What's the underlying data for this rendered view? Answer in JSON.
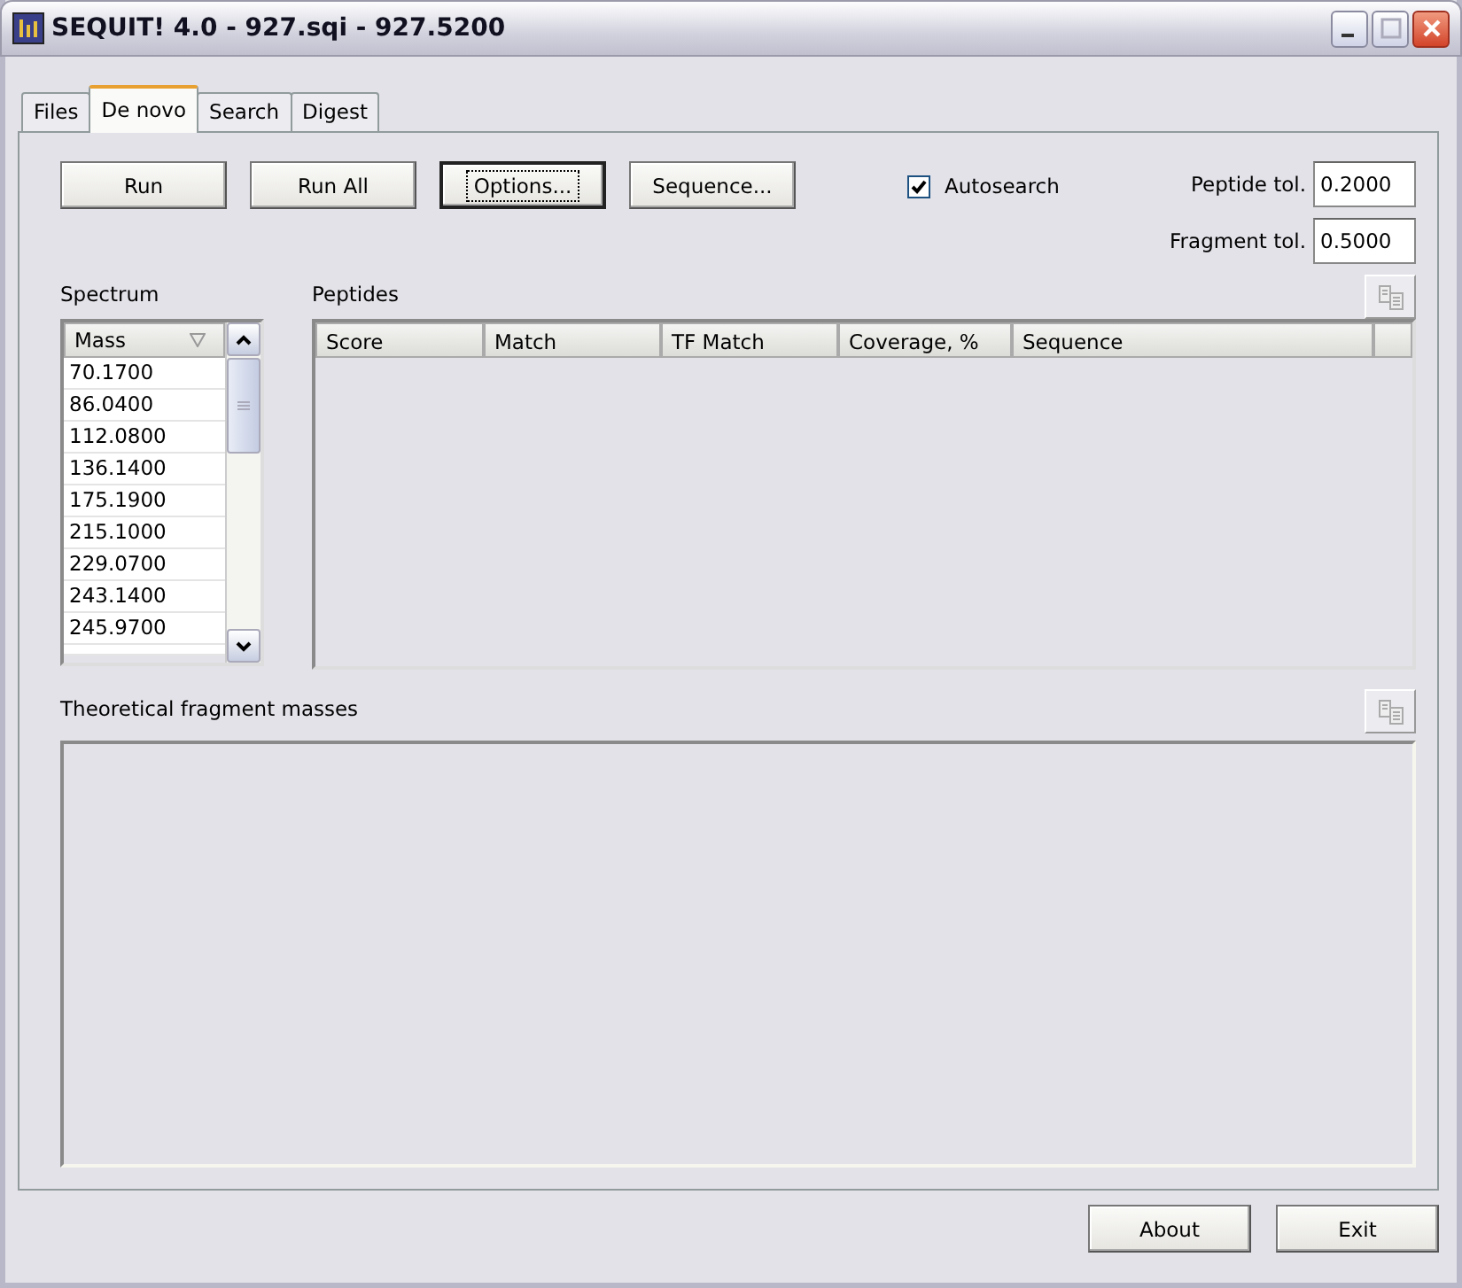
{
  "window": {
    "title": "SEQUIT! 4.0 - 927.sqi - 927.5200"
  },
  "tabs": [
    {
      "label": "Files",
      "selected": false
    },
    {
      "label": "De novo",
      "selected": true
    },
    {
      "label": "Search",
      "selected": false
    },
    {
      "label": "Digest",
      "selected": false
    }
  ],
  "actions": [
    {
      "label": "Run",
      "focused": false
    },
    {
      "label": "Run All",
      "focused": false
    },
    {
      "label": "Options...",
      "focused": true
    },
    {
      "label": "Sequence...",
      "focused": false
    }
  ],
  "autosearch": {
    "label": "Autosearch",
    "checked": true
  },
  "tolerances": [
    {
      "label": "Peptide tol.",
      "value": "0.2000"
    },
    {
      "label": "Fragment tol.",
      "value": "0.5000"
    }
  ],
  "spectrum": {
    "label": "Spectrum",
    "column": "Mass",
    "rows": [
      "70.1700",
      "86.0400",
      "112.0800",
      "136.1400",
      "175.1900",
      "215.1000",
      "229.0700",
      "243.1400",
      "245.9700"
    ]
  },
  "peptides": {
    "label": "Peptides",
    "columns": [
      "Score",
      "Match",
      "TF Match",
      "Coverage, %",
      "Sequence"
    ]
  },
  "fragments": {
    "label": "Theoretical fragment masses"
  },
  "footer": [
    {
      "label": "About"
    },
    {
      "label": "Exit"
    }
  ]
}
